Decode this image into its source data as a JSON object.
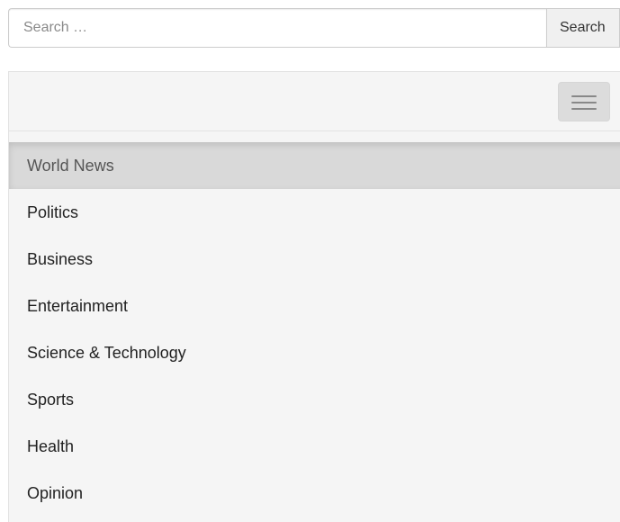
{
  "search": {
    "placeholder": "Search …",
    "button_label": "Search"
  },
  "navbar": {
    "toggle_icon": "hamburger-icon",
    "items": [
      {
        "label": "World News",
        "active": true
      },
      {
        "label": "Politics",
        "active": false
      },
      {
        "label": "Business",
        "active": false
      },
      {
        "label": "Entertainment",
        "active": false
      },
      {
        "label": "Science & Technology",
        "active": false
      },
      {
        "label": "Sports",
        "active": false
      },
      {
        "label": "Health",
        "active": false
      },
      {
        "label": "Opinion",
        "active": false
      }
    ]
  }
}
